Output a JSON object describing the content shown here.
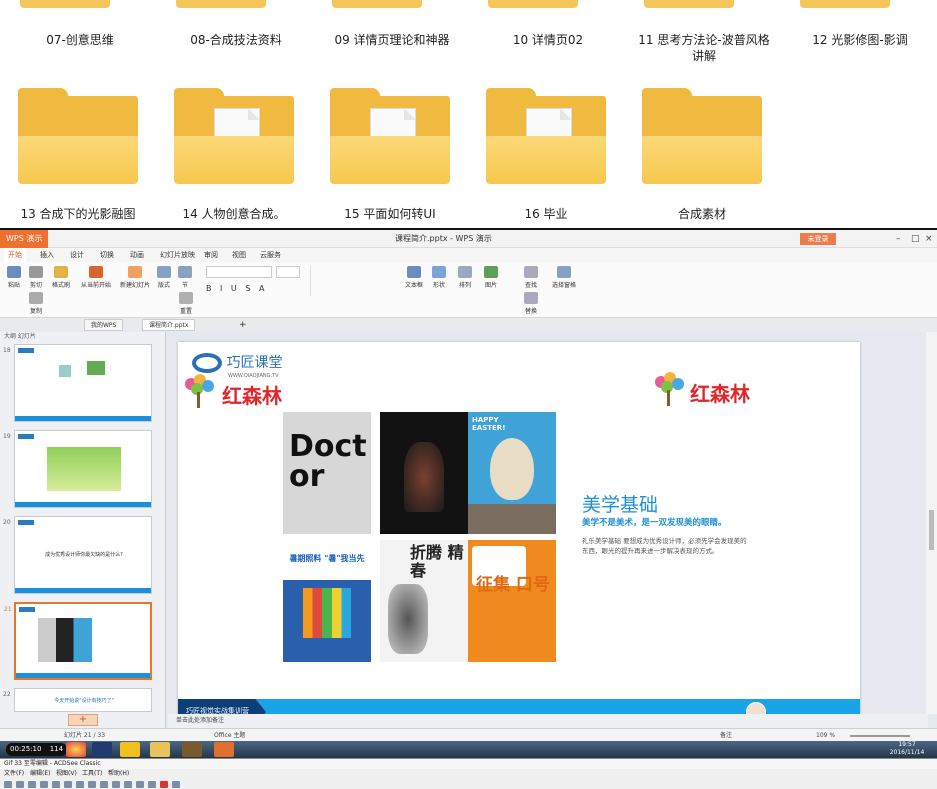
{
  "explorer": {
    "row1": [
      {
        "label": "07-创意思维"
      },
      {
        "label": "08-合成技法资料"
      },
      {
        "label": "09 详情页理论和神器"
      },
      {
        "label": "10 详情页02"
      },
      {
        "label": "11 思考方法论-波普风格讲解"
      },
      {
        "label": "12 光影修图-影调"
      }
    ],
    "row2": [
      {
        "label": "13 合成下的光影融图"
      },
      {
        "label": "14 人物创意合成。"
      },
      {
        "label": "15 平面如何转UI"
      },
      {
        "label": "16 毕业"
      },
      {
        "label": "合成素材"
      }
    ]
  },
  "wps": {
    "app_menu": "WPS 演示",
    "doc_title": "课程简介.pptx - WPS 演示",
    "login": "未登录",
    "ribbon_tabs": [
      "开始",
      "插入",
      "设计",
      "切换",
      "动画",
      "幻灯片放映",
      "审阅",
      "视图",
      "云服务"
    ],
    "ribbon_buttons": [
      "粘贴",
      "剪切",
      "复制",
      "格式刷",
      "从当前开始",
      "新建幻灯片",
      "版式",
      "节",
      "重置",
      "文本框",
      "形状",
      "排列",
      "图片",
      "查找",
      "替换",
      "选择窗格"
    ],
    "doc_tabs": [
      "我的WPS",
      "课程简介.pptx"
    ],
    "thumb_header": "大纲  幻灯片",
    "thumbs": [
      {
        "num": "18",
        "text": ""
      },
      {
        "num": "19",
        "text": ""
      },
      {
        "num": "20",
        "text": "成为优秀设计师你最欠缺的是什么?"
      },
      {
        "num": "21",
        "text": ""
      },
      {
        "num": "22",
        "text": "今天开始说\"设计有技巧了\""
      }
    ],
    "add_slide": "+",
    "notes": "单击此处添加备注",
    "status": {
      "slide_count": "幻灯片 21 / 33",
      "theme": "Office 主题",
      "notes_btn": "备注",
      "zoom": "109 %"
    }
  },
  "slide": {
    "logo_main": "巧匠课堂",
    "logo_sub": "WWW.QIAOJIANG.TV",
    "hsl": "红森林",
    "posters": [
      {
        "name": "doctor",
        "text": "Doctor",
        "bg": "#d7d7d7"
      },
      {
        "name": "dark-figure",
        "text": "",
        "bg": "#121212"
      },
      {
        "name": "easter",
        "text": "HAPPY EASTER!",
        "bg": "#3fa3d8"
      },
      {
        "name": "summer-school",
        "text": "暑期照料 \"暑\"我当先",
        "bg": "#2a5fae"
      },
      {
        "name": "zheteng",
        "text": "折腾 精春",
        "bg": "#f3f3f3"
      },
      {
        "name": "zhengji",
        "text": "征集 口号",
        "bg": "#f08a1f"
      }
    ],
    "title": "美学基础",
    "subtitle": "美学不是美术，是一双发现美的眼睛。",
    "body": "礼乐美学基础 要想成为优秀设计师，必须先学会发现美的东西，眼光的提升再来进一步解决表现的方式。",
    "footer": "巧匠视觉实战集训营"
  },
  "taskbar": {
    "timer": "00:25:10",
    "timer_count": "114",
    "clock_time": "19:57",
    "clock_date": "2016/11/14"
  },
  "bottom_app": {
    "title": "Gif 33 至零编辑 - ACDSee Classic",
    "menu": [
      "文件(F)",
      "编辑(E)",
      "视图(V)",
      "工具(T)",
      "帮助(H)"
    ]
  },
  "colors": {
    "accent": "#d0561e",
    "slide_blue": "#1aa3e6",
    "folder": "#f6c84e"
  }
}
